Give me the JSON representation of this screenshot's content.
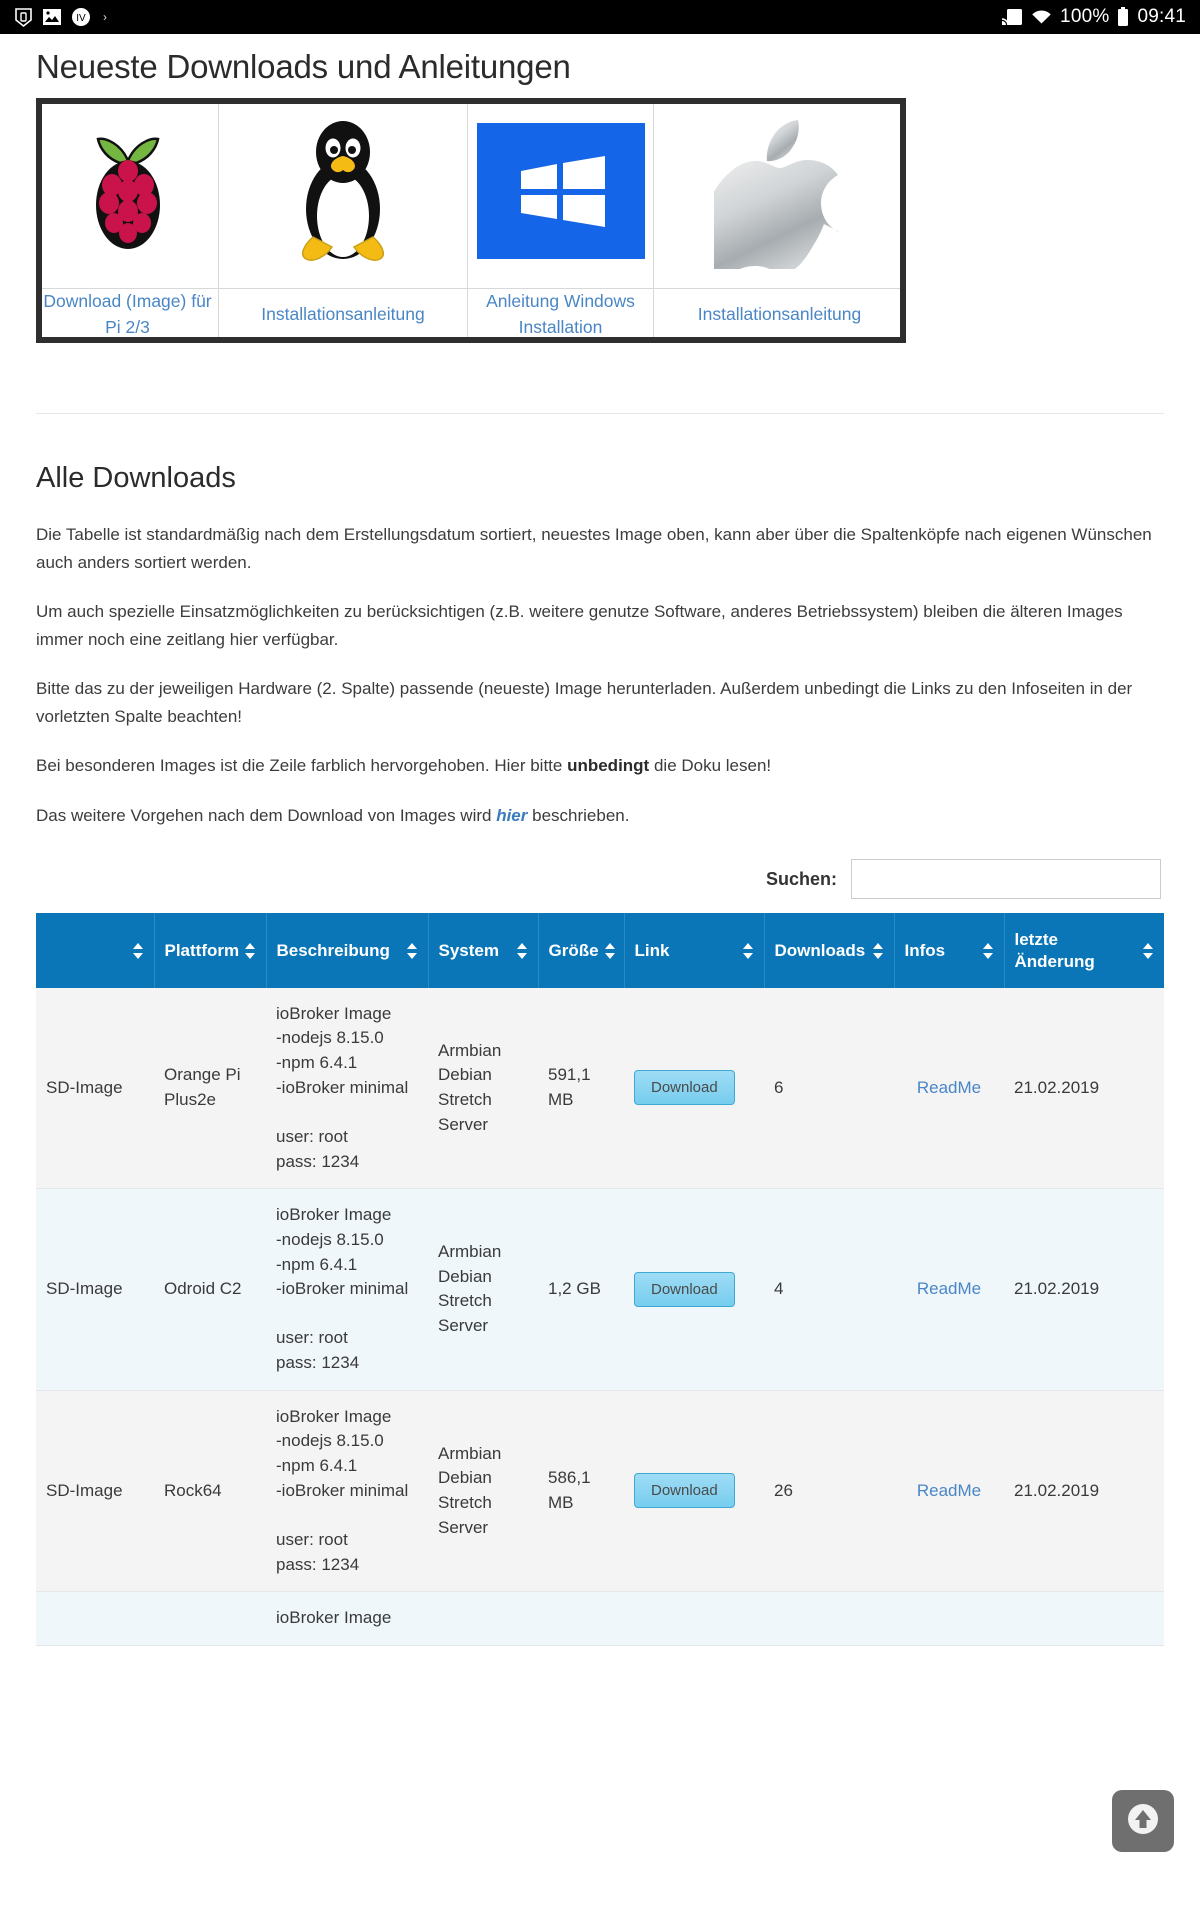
{
  "statusbar": {
    "icons": [
      "shield-icon",
      "image-icon",
      "iv-badge-icon",
      "dot-icon"
    ],
    "cast_icon": "screen-cast-icon",
    "wifi_icon": "wifi-icon",
    "battery_text": "100%",
    "battery_icon": "battery-full-icon",
    "time": "09:41"
  },
  "header": {
    "title": "Neueste Downloads und Anleitungen"
  },
  "featured": {
    "cells": [
      {
        "icon": "raspberry-pi-logo",
        "link": "Download (Image) für Pi 2/3"
      },
      {
        "icon": "linux-tux-logo",
        "link": "Installationsanleitung"
      },
      {
        "icon": "windows-logo",
        "link": "Anleitung Windows Installation"
      },
      {
        "icon": "apple-logo",
        "link": "Installationsanleitung"
      }
    ]
  },
  "section": {
    "title": "Alle Downloads",
    "paragraphs": [
      "Die Tabelle ist standardmäßig nach dem Erstellungsdatum sortiert, neuestes Image oben, kann aber über die Spaltenköpfe nach eigenen Wünschen auch anders sortiert werden.",
      "Um auch spezielle Einsatzmöglichkeiten zu berücksichtigen (z.B. weitere genutze Software, anderes Betriebssystem) bleiben die älteren Images immer noch eine zeitlang hier verfügbar.",
      "Bitte das zu der jeweiligen Hardware (2. Spalte) passende (neueste) Image herunterladen. Außerdem unbedingt die Links zu den Infoseiten in der vorletzten Spalte beachten!"
    ],
    "para_bold_prefix": "Bei besonderen Images ist die Zeile farblich hervorgehoben. Hier bitte ",
    "para_bold_word": "unbedingt",
    "para_bold_suffix": " die Doku lesen!",
    "para_link_prefix": "Das weitere Vorgehen nach dem Download von Images wird ",
    "para_link_word": "hier",
    "para_link_suffix": " beschrieben."
  },
  "search": {
    "label": "Suchen:",
    "value": "",
    "placeholder": ""
  },
  "table": {
    "columns": [
      {
        "label": "",
        "sortable": true
      },
      {
        "label": "Plattform",
        "sortable": true
      },
      {
        "label": "Beschreibung",
        "sortable": true
      },
      {
        "label": "System",
        "sortable": true
      },
      {
        "label": "Größe",
        "sortable": true
      },
      {
        "label": "Link",
        "sortable": true
      },
      {
        "label": "Downloads",
        "sortable": true
      },
      {
        "label": "Infos",
        "sortable": true
      },
      {
        "label": "letzte Änderung",
        "sortable": true
      }
    ],
    "rows": [
      {
        "style": "plain",
        "type": "SD-Image",
        "platform": "Orange Pi Plus2e",
        "description": "ioBroker Image\n-nodejs 8.15.0\n-npm 6.4.1\n-ioBroker minimal\n\nuser: root\npass: 1234",
        "system": "Armbian Debian Stretch Server",
        "size": "591,1 MB",
        "link_label": "Download",
        "downloads": "6",
        "infos": "ReadMe",
        "changed": "21.02.2019"
      },
      {
        "style": "highlight",
        "type": "SD-Image",
        "platform": "Odroid C2",
        "description": "ioBroker Image\n-nodejs 8.15.0\n-npm 6.4.1\n-ioBroker minimal\n\nuser: root\npass: 1234",
        "system": "Armbian Debian Stretch Server",
        "size": "1,2 GB",
        "link_label": "Download",
        "downloads": "4",
        "infos": "ReadMe",
        "changed": "21.02.2019"
      },
      {
        "style": "plain",
        "type": "SD-Image",
        "platform": "Rock64",
        "description": "ioBroker Image\n-nodejs 8.15.0\n-npm 6.4.1\n-ioBroker minimal\n\nuser: root\npass: 1234",
        "system": "Armbian Debian Stretch Server",
        "size": "586,1 MB",
        "link_label": "Download",
        "downloads": "26",
        "infos": "ReadMe",
        "changed": "21.02.2019"
      },
      {
        "style": "highlight",
        "type": "",
        "platform": "",
        "description": "ioBroker Image",
        "system": "",
        "size": "",
        "link_label": "",
        "downloads": "",
        "infos": "",
        "changed": ""
      }
    ]
  },
  "to_top": {
    "icon": "arrow-up-circle-icon"
  },
  "colors": {
    "table_header": "#0a76b8",
    "link": "#4a86c5",
    "highlight_row": "#eff7fb",
    "plain_row": "#f4f4f4"
  }
}
